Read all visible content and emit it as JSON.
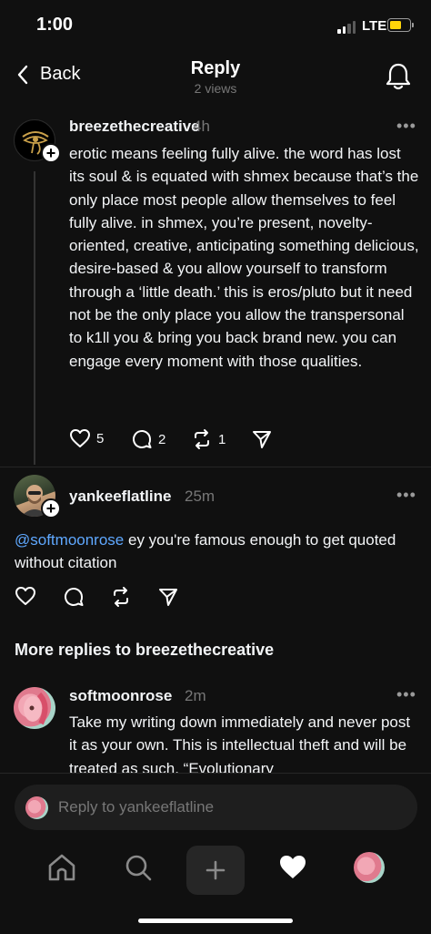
{
  "status_bar": {
    "time": "1:00",
    "network": "LTE"
  },
  "header": {
    "back_label": "Back",
    "title": "Reply",
    "subtitle": "2 views"
  },
  "main_post": {
    "username": "breezethecreative",
    "time": "4h",
    "body": "erotic means feeling fully alive. the word has lost its soul & is equated with shmex because that’s the only place most people allow themselves to feel fully alive. in shmex, you’re present, novelty-oriented, creative, anticipating something delicious, desire-based & you allow yourself to transform through a ‘little death.’ this is eros/pluto but it need not be the only place you allow the transpersonal to k1ll you & bring you back brand new. you can engage every moment with those qualities.",
    "likes": "5",
    "replies": "2",
    "reposts": "1"
  },
  "reply_post": {
    "username": "yankeeflatline",
    "time": "25m",
    "mention": "@softmoonrose",
    "body": " ey you're famous enough to get quoted without citation"
  },
  "more_replies_title": "More replies to breezethecreative",
  "third_post": {
    "username": "softmoonrose",
    "time": "2m",
    "body": "Take my writing down immediately and never post it as your own. This is intellectual theft and will be treated as such. “Evolutionary"
  },
  "reply_input": {
    "placeholder": "Reply to yankeeflatline"
  },
  "icons": {
    "back": "chevron-left-icon",
    "bell": "bell-icon",
    "like": "heart-icon",
    "comment": "comment-icon",
    "repost": "repost-icon",
    "share": "send-icon",
    "more": "more-icon",
    "home": "home-icon",
    "search": "search-icon",
    "compose": "plus-icon",
    "activity": "heart-filled-icon"
  },
  "colors": {
    "background": "#101010",
    "text": "#f3f5f7",
    "muted": "#777777",
    "mention": "#5fa8ff",
    "battery": "#ffd60a"
  }
}
